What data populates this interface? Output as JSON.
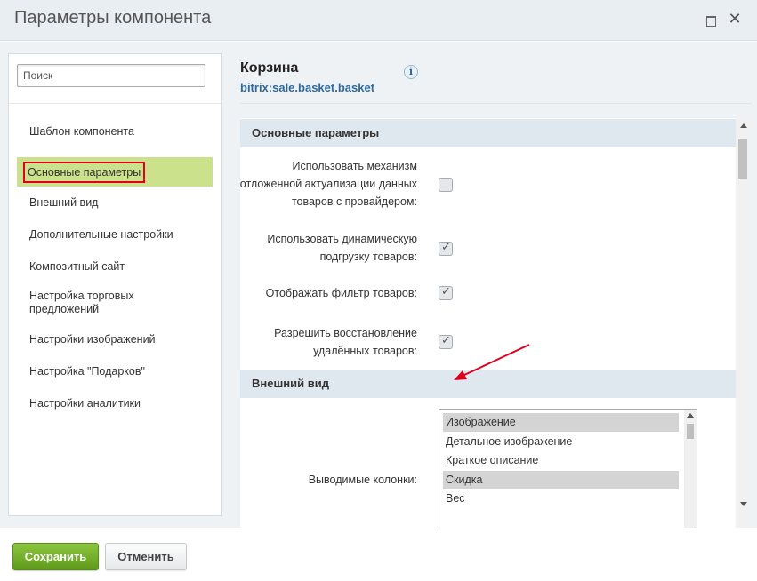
{
  "dialog": {
    "title": "Параметры компонента",
    "maximize_icon": "maximize-icon",
    "close_icon": "close-icon"
  },
  "sidebar": {
    "search_placeholder": "Поиск",
    "items": [
      {
        "label": "Шаблон компонента"
      },
      {
        "label": "Основные параметры",
        "active": true
      },
      {
        "label": "Внешний вид"
      },
      {
        "label": "Дополнительные настройки"
      },
      {
        "label": "Композитный сайт"
      },
      {
        "label": "Настройка торговых предложений"
      },
      {
        "label": "Настройки изображений"
      },
      {
        "label": "Настройка \"Подарков\""
      },
      {
        "label": "Настройки аналитики"
      }
    ]
  },
  "component": {
    "name": "Корзина",
    "code": "bitrix:sale.basket.basket",
    "info_icon": "info-icon"
  },
  "sections": {
    "main": {
      "title": "Основные параметры",
      "params": [
        {
          "label": "Использовать механизм отложенной актуализации данных товаров с провайдером:",
          "checked": false
        },
        {
          "label": "Использовать динамическую подгрузку товаров:",
          "checked": true
        },
        {
          "label": "Отображать фильтр товаров:",
          "checked": true
        },
        {
          "label": "Разрешить восстановление удалённых товаров:",
          "checked": true
        }
      ]
    },
    "appearance": {
      "title": "Внешний вид",
      "columns_label": "Выводимые колонки:",
      "columns_options": [
        {
          "label": "Изображение",
          "selected": true
        },
        {
          "label": "Детальное изображение",
          "selected": false
        },
        {
          "label": "Краткое описание",
          "selected": false
        },
        {
          "label": "Скидка",
          "selected": true
        },
        {
          "label": "Вес",
          "selected": false
        }
      ]
    }
  },
  "footer": {
    "save_label": "Сохранить",
    "cancel_label": "Отменить"
  },
  "colors": {
    "active_nav": "#cbe18b",
    "highlight_border": "#e0001b",
    "save_button": "#6fae29",
    "link": "#2d6a9e"
  }
}
